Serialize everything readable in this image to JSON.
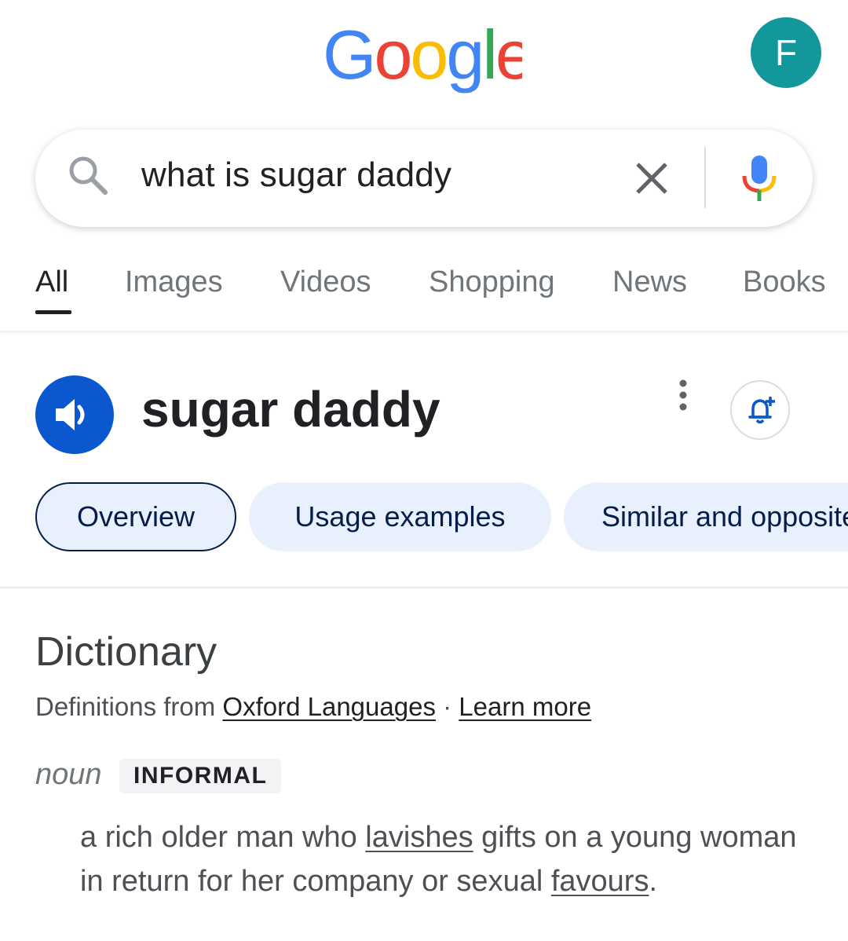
{
  "header": {
    "logo_text": "Google",
    "logo_colors": [
      "#4285F4",
      "#EA4335",
      "#FBBC05",
      "#4285F4",
      "#34A853",
      "#EA4335"
    ],
    "avatar_letter": "F",
    "avatar_color": "#12979b"
  },
  "search": {
    "query": "what is sugar daddy",
    "search_icon": "search-icon",
    "clear_icon": "close-icon",
    "mic_icon": "microphone-icon"
  },
  "tabs": [
    {
      "label": "All",
      "active": true
    },
    {
      "label": "Images",
      "active": false
    },
    {
      "label": "Videos",
      "active": false
    },
    {
      "label": "Shopping",
      "active": false
    },
    {
      "label": "News",
      "active": false
    },
    {
      "label": "Books",
      "active": false
    }
  ],
  "entry": {
    "word": "sugar daddy",
    "speaker_icon": "speaker-icon",
    "more_icon": "more-vert-icon",
    "alert_icon": "bell-plus-icon",
    "accent_color": "#0b57d0"
  },
  "chips": [
    {
      "label": "Overview",
      "active": true
    },
    {
      "label": "Usage examples",
      "active": false
    },
    {
      "label": "Similar and opposite words",
      "active": false
    }
  ],
  "dictionary": {
    "title": "Dictionary",
    "source_prefix": "Definitions from",
    "source_link": "Oxford Languages",
    "separator": "·",
    "learn_more": "Learn more",
    "part_of_speech": "noun",
    "register": "INFORMAL",
    "definition": {
      "text_1": "a rich older man who ",
      "link_1": "lavishes",
      "text_2": " gifts on a young woman in return for her company or sexual ",
      "link_2": "favours",
      "text_3": "."
    }
  }
}
